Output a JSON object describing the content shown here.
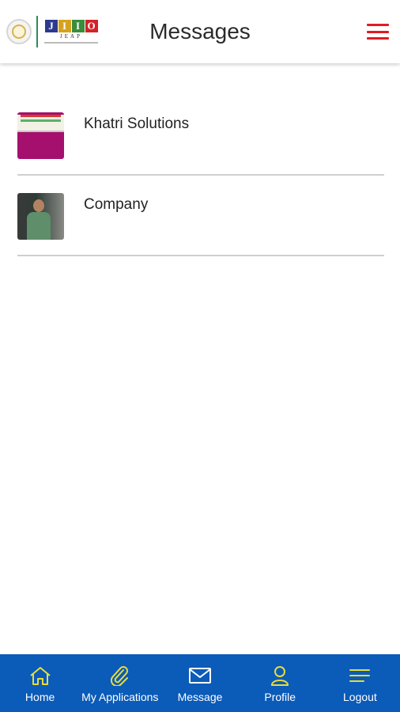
{
  "header": {
    "title": "Messages",
    "logo": {
      "letters": [
        "J",
        "I",
        "I",
        "O"
      ],
      "letter_colors": [
        "#2b3a8f",
        "#d6a21e",
        "#3a8d3a",
        "#d2232a"
      ],
      "sub": "JEAP"
    }
  },
  "messages": [
    {
      "name": "Khatri Solutions"
    },
    {
      "name": "Company"
    }
  ],
  "tabs": [
    {
      "label": "Home",
      "icon": "home-icon"
    },
    {
      "label": "My Applications",
      "icon": "paperclip-icon"
    },
    {
      "label": "Message",
      "icon": "mail-icon"
    },
    {
      "label": "Profile",
      "icon": "user-icon"
    },
    {
      "label": "Logout",
      "icon": "menu-lines-icon"
    }
  ],
  "colors": {
    "accent_red": "#e11b22",
    "tabbar_blue": "#0b5bb8",
    "tab_icon_yellow": "#e8dc3a"
  }
}
